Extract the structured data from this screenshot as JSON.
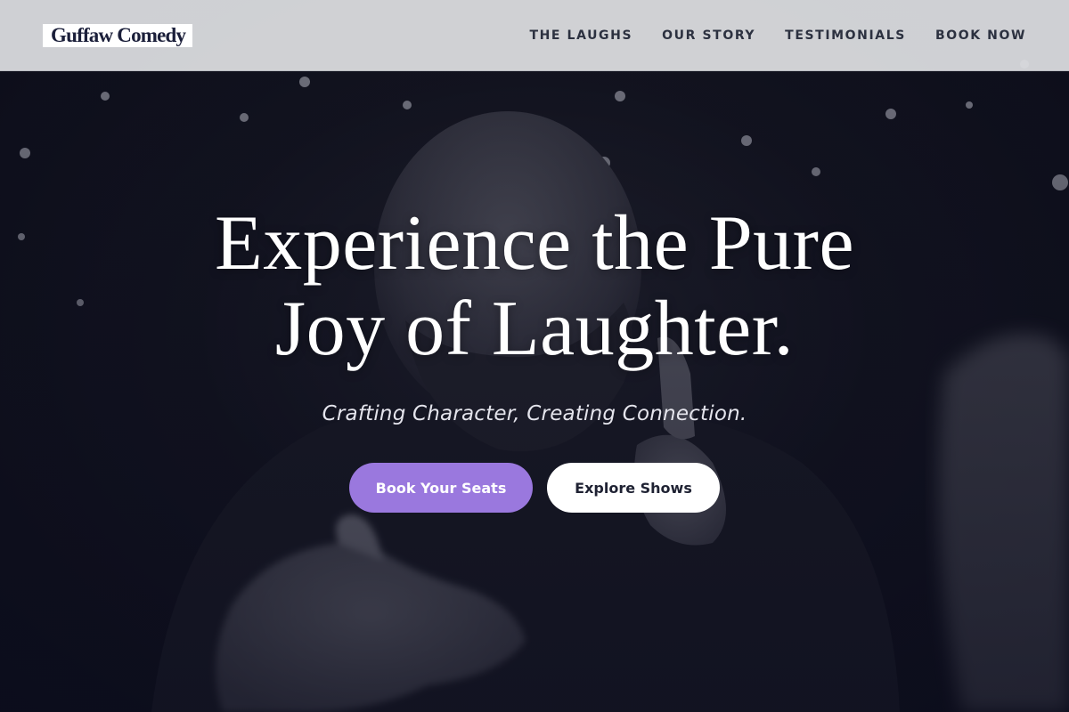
{
  "brand": {
    "name": "Guffaw Comedy"
  },
  "nav": {
    "links": [
      {
        "label": "THE LAUGHS"
      },
      {
        "label": "OUR STORY"
      },
      {
        "label": "TESTIMONIALS"
      },
      {
        "label": "BOOK NOW"
      }
    ]
  },
  "hero": {
    "title_line1": "Experience the Pure",
    "title_line2": "Joy of Laughter.",
    "tagline": "Crafting Character, Creating Connection.",
    "primary_cta": "Book Your Seats",
    "secondary_cta": "Explore Shows",
    "background_image_alt": "Black and white photo of a bald bearded comedian pointing toward the camera"
  },
  "colors": {
    "accent": "#9a78de",
    "nav_bg": "#dcdde0",
    "text_dark": "#2c3140",
    "hero_overlay": "#0c0d1e"
  }
}
